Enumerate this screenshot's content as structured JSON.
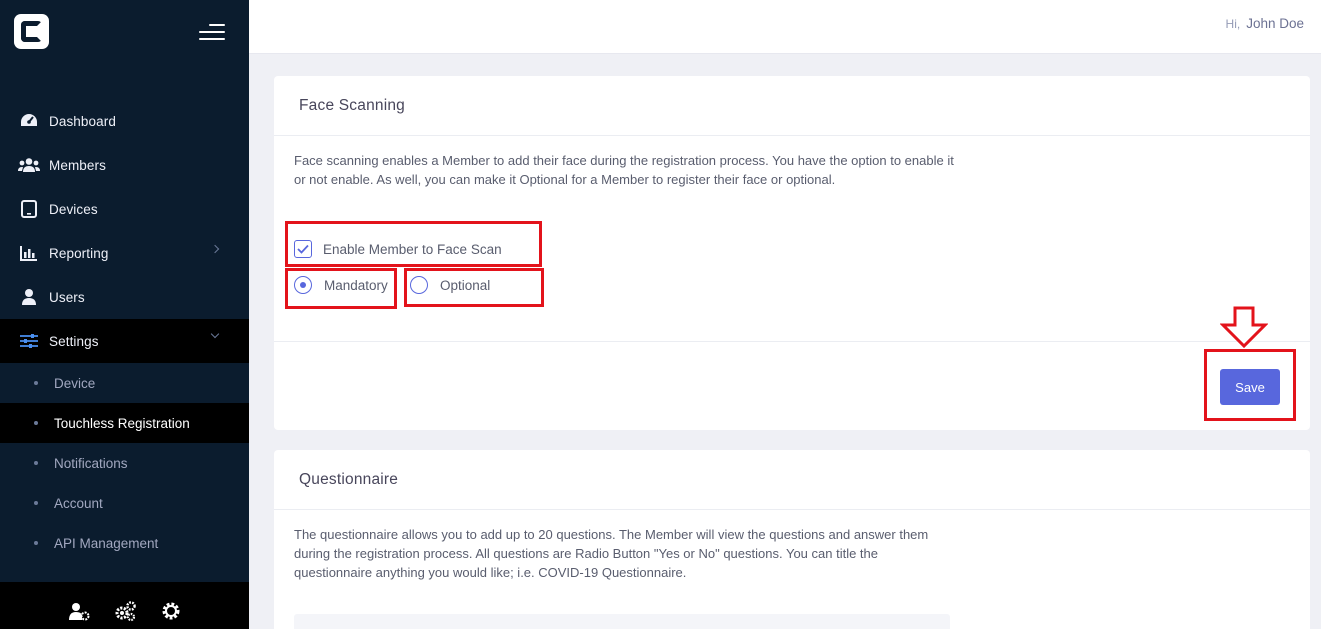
{
  "topbar": {
    "greeting_prefix": "Hi,",
    "user_name": "John Doe"
  },
  "sidebar": {
    "items": [
      {
        "label": "Dashboard",
        "icon": "dashboard-icon"
      },
      {
        "label": "Members",
        "icon": "users-icon"
      },
      {
        "label": "Devices",
        "icon": "tablet-icon"
      },
      {
        "label": "Reporting",
        "icon": "bar-chart-icon"
      },
      {
        "label": "Users",
        "icon": "user-icon"
      },
      {
        "label": "Settings",
        "icon": "sliders-icon"
      }
    ],
    "settings_sub": [
      {
        "label": "Device"
      },
      {
        "label": "Touchless Registration"
      },
      {
        "label": "Notifications"
      },
      {
        "label": "Account"
      },
      {
        "label": "API Management"
      }
    ],
    "footer_icons": [
      "user-settings-icon",
      "gears-icon",
      "gear-icon"
    ]
  },
  "face_scanning": {
    "title": "Face Scanning",
    "description": "Face scanning enables a Member to add their face during the registration process. You have the option to enable it or not enable. As well, you can make it Optional for a Member to register their face or optional.",
    "enable_label": "Enable Member to Face Scan",
    "enable_checked": true,
    "mandatory_label": "Mandatory",
    "optional_label": "Optional",
    "selected": "Mandatory",
    "save_label": "Save"
  },
  "questionnaire": {
    "title": "Questionnaire",
    "description": "The questionnaire allows you to add up to 20 questions. The Member will view the questions and answer them during the registration process. All questions are Radio Button \"Yes or No\" questions. You can title the questionnaire anything you would like; i.e. COVID-19 Questionnaire."
  },
  "colors": {
    "sidebar_bg": "#0b1c2e",
    "accent": "#5867dd",
    "annotation_red": "#e3131b"
  }
}
